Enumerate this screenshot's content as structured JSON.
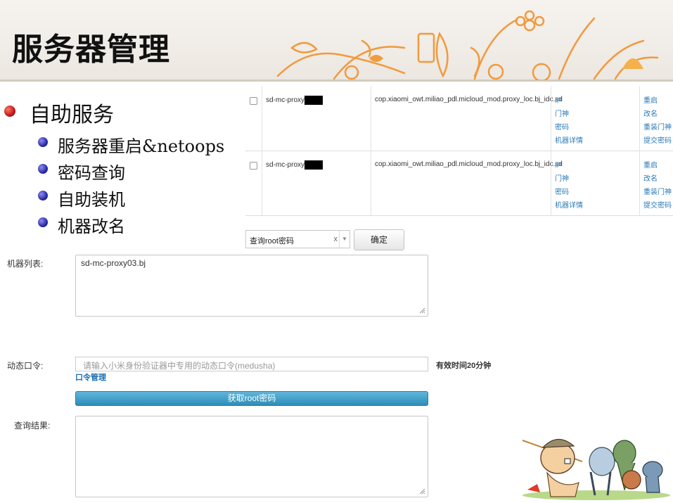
{
  "slide": {
    "title": "服务器管理"
  },
  "bullets": {
    "main": "自助服务",
    "subs": [
      "服务器重启&netoops",
      "密码查询",
      "自助装机",
      "机器改名"
    ]
  },
  "table": {
    "rows": [
      {
        "hostname": "sd-mc-proxy",
        "service": "cop.xiaomi_owt.miliao_pdl.micloud_mod.proxy_loc.bj_idc.sd",
        "links": [
          "IP",
          "门神",
          "密码",
          "机器详情"
        ],
        "actions": [
          "重启",
          "改名",
          "重装门神",
          "提交密码"
        ]
      },
      {
        "hostname": "sd-mc-proxy",
        "service": "cop.xiaomi_owt.miliao_pdl.micloud_mod.proxy_loc.bj_idc.sd",
        "links": [
          "IP",
          "门神",
          "密码",
          "机器详情"
        ],
        "actions": [
          "重启",
          "改名",
          "重装门神",
          "提交密码"
        ]
      }
    ]
  },
  "query": {
    "select_value": "查询root密码",
    "clear": "x",
    "ok_label": "确定"
  },
  "form": {
    "machine_list_label": "机器列表:",
    "machine_list_value": "sd-mc-proxy03.bj",
    "otp_label": "动态口令:",
    "otp_placeholder": "请输入小米身份验证器中专用的动态口令(medusha)",
    "validity": "有效时间20分钟",
    "otp_manage": "口令管理",
    "get_button": "获取root密码",
    "result_label": "查询结果:"
  }
}
